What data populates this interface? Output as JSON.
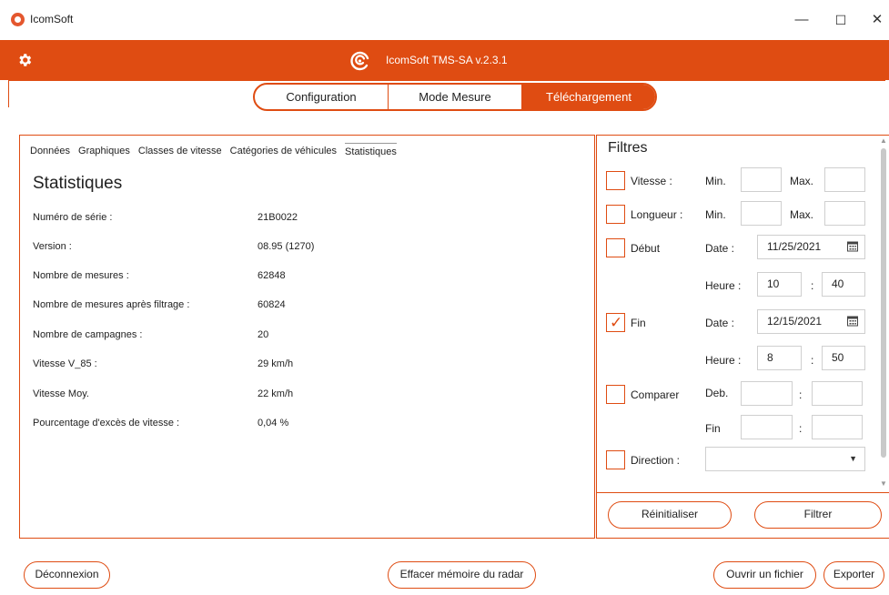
{
  "window": {
    "title": "IcomSoft",
    "minimize_glyph": "—",
    "maximize_glyph": "☐",
    "close_glyph": "✕"
  },
  "header": {
    "title": "IcomSoft TMS-SA  v.2.3.1",
    "accent_color": "#df4c12"
  },
  "main_tabs": [
    {
      "label": "Configuration",
      "active": false
    },
    {
      "label": "Mode Mesure",
      "active": false
    },
    {
      "label": "Téléchargement",
      "active": true
    }
  ],
  "sub_tabs": [
    {
      "label": "Données"
    },
    {
      "label": "Graphiques"
    },
    {
      "label": "Classes de vitesse"
    },
    {
      "label": "Catégories de véhicules"
    },
    {
      "label": "Statistiques",
      "active": true
    }
  ],
  "statistics": {
    "title": "Statistiques",
    "rows": [
      {
        "label": "Numéro de série :",
        "value": "21B0022"
      },
      {
        "label": "Version :",
        "value": "08.95 (1270)"
      },
      {
        "label": "Nombre de mesures :",
        "value": "62848"
      },
      {
        "label": "Nombre de mesures après filtrage :",
        "value": "60824"
      },
      {
        "label": "Nombre de campagnes :",
        "value": "20"
      },
      {
        "label": "Vitesse V_85 :",
        "value": "29  km/h"
      },
      {
        "label": "Vitesse Moy.",
        "value": "22  km/h"
      },
      {
        "label": "Pourcentage d'excès de vitesse :",
        "value": "0,04 %"
      }
    ]
  },
  "filters": {
    "title": "Filtres",
    "vitesse": {
      "label": "Vitesse :",
      "checked": false,
      "min_label": "Min.",
      "max_label": "Max.",
      "min_value": "",
      "max_value": ""
    },
    "longueur": {
      "label": "Longueur :",
      "checked": false,
      "min_label": "Min.",
      "max_label": "Max.",
      "min_value": "",
      "max_value": ""
    },
    "debut": {
      "label": "Début",
      "checked": false,
      "date_label": "Date :",
      "date_value": "11/25/2021",
      "heure_label": "Heure :",
      "hour": "10",
      "minute": "40"
    },
    "fin": {
      "label": "Fin",
      "checked": true,
      "date_label": "Date :",
      "date_value": "12/15/2021",
      "heure_label": "Heure :",
      "hour": "8",
      "minute": "50"
    },
    "comparer": {
      "label": "Comparer",
      "checked": false,
      "deb_label": "Deb.",
      "fin_label": "Fin",
      "separator": ":"
    },
    "direction": {
      "label": "Direction :",
      "checked": false,
      "value": ""
    },
    "time_separator": ":",
    "reset_label": "Réinitialiser",
    "apply_label": "Filtrer"
  },
  "bottom": {
    "disconnect_label": "Déconnexion",
    "clear_memory_label": "Effacer mémoire du radar",
    "open_file_label": "Ouvrir un fichier",
    "export_label": "Exporter"
  }
}
